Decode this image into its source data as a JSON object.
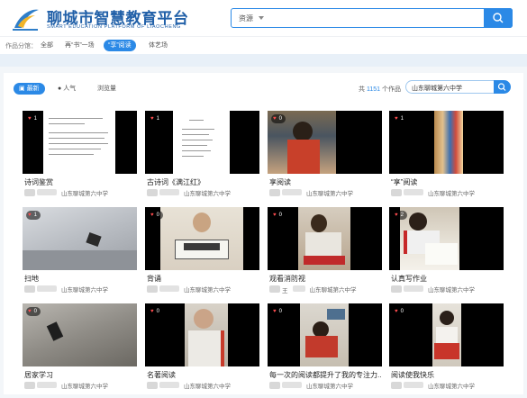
{
  "header": {
    "title": "聊城市智慧教育平台",
    "subtitle": "SMART EDUCATION PLATFORM OF LIAOCHENG",
    "search_type": "资源",
    "search_placeholder": ""
  },
  "categories": {
    "label": "作品分馆：",
    "items": [
      {
        "label": "全部",
        "active": false
      },
      {
        "label": "再“书”一场",
        "active": false
      },
      {
        "label": "“享”阅读",
        "active": true
      },
      {
        "label": "体艺场",
        "active": false
      }
    ]
  },
  "sort": {
    "items": [
      {
        "label": "最新",
        "icon": "new-icon",
        "active": true
      },
      {
        "label": "人气",
        "icon": "fire-icon",
        "active": false
      },
      {
        "label": "浏览量",
        "active": false
      }
    ],
    "total_prefix": "共",
    "total": "1151",
    "total_suffix": "个作品",
    "school_search": "山东聊城第六中学"
  },
  "works": [
    {
      "title": "诗词鉴赏",
      "likes": "1",
      "school": "山东聊城第六中学",
      "author": ""
    },
    {
      "title": "古诗词《满江红》",
      "likes": "1",
      "school": "山东聊城第六中学",
      "author": ""
    },
    {
      "title": "享阅读",
      "likes": "0",
      "school": "山东聊城第六中学",
      "author": ""
    },
    {
      "title": "“享”阅读",
      "likes": "1",
      "school": "山东聊城第六中学",
      "author": ""
    },
    {
      "title": "扫地",
      "likes": "1",
      "school": "山东聊城第六中学",
      "author": ""
    },
    {
      "title": "背诵",
      "likes": "0",
      "school": "山东聊城第六中学",
      "author": ""
    },
    {
      "title": "观看消防视",
      "likes": "0",
      "school": "山东聊城第六中学",
      "author": "王"
    },
    {
      "title": "认真写作业",
      "likes": "2",
      "school": "山东聊城第六中学",
      "author": ""
    },
    {
      "title": "居家学习",
      "likes": "0",
      "school": "山东聊城第六中学",
      "author": ""
    },
    {
      "title": "名著阅读",
      "likes": "0",
      "school": "山东聊城第六中学",
      "author": ""
    },
    {
      "title": "每一次的阅读都提升了我的专注力...",
      "likes": "0",
      "school": "山东聊城第六中学",
      "author": ""
    },
    {
      "title": "阅读使我快乐",
      "likes": "0",
      "school": "山东聊城第六中学",
      "author": ""
    }
  ],
  "colors": {
    "accent": "#2b89e6",
    "brand": "#2160a8",
    "like_heart": "#ff4d4f"
  }
}
